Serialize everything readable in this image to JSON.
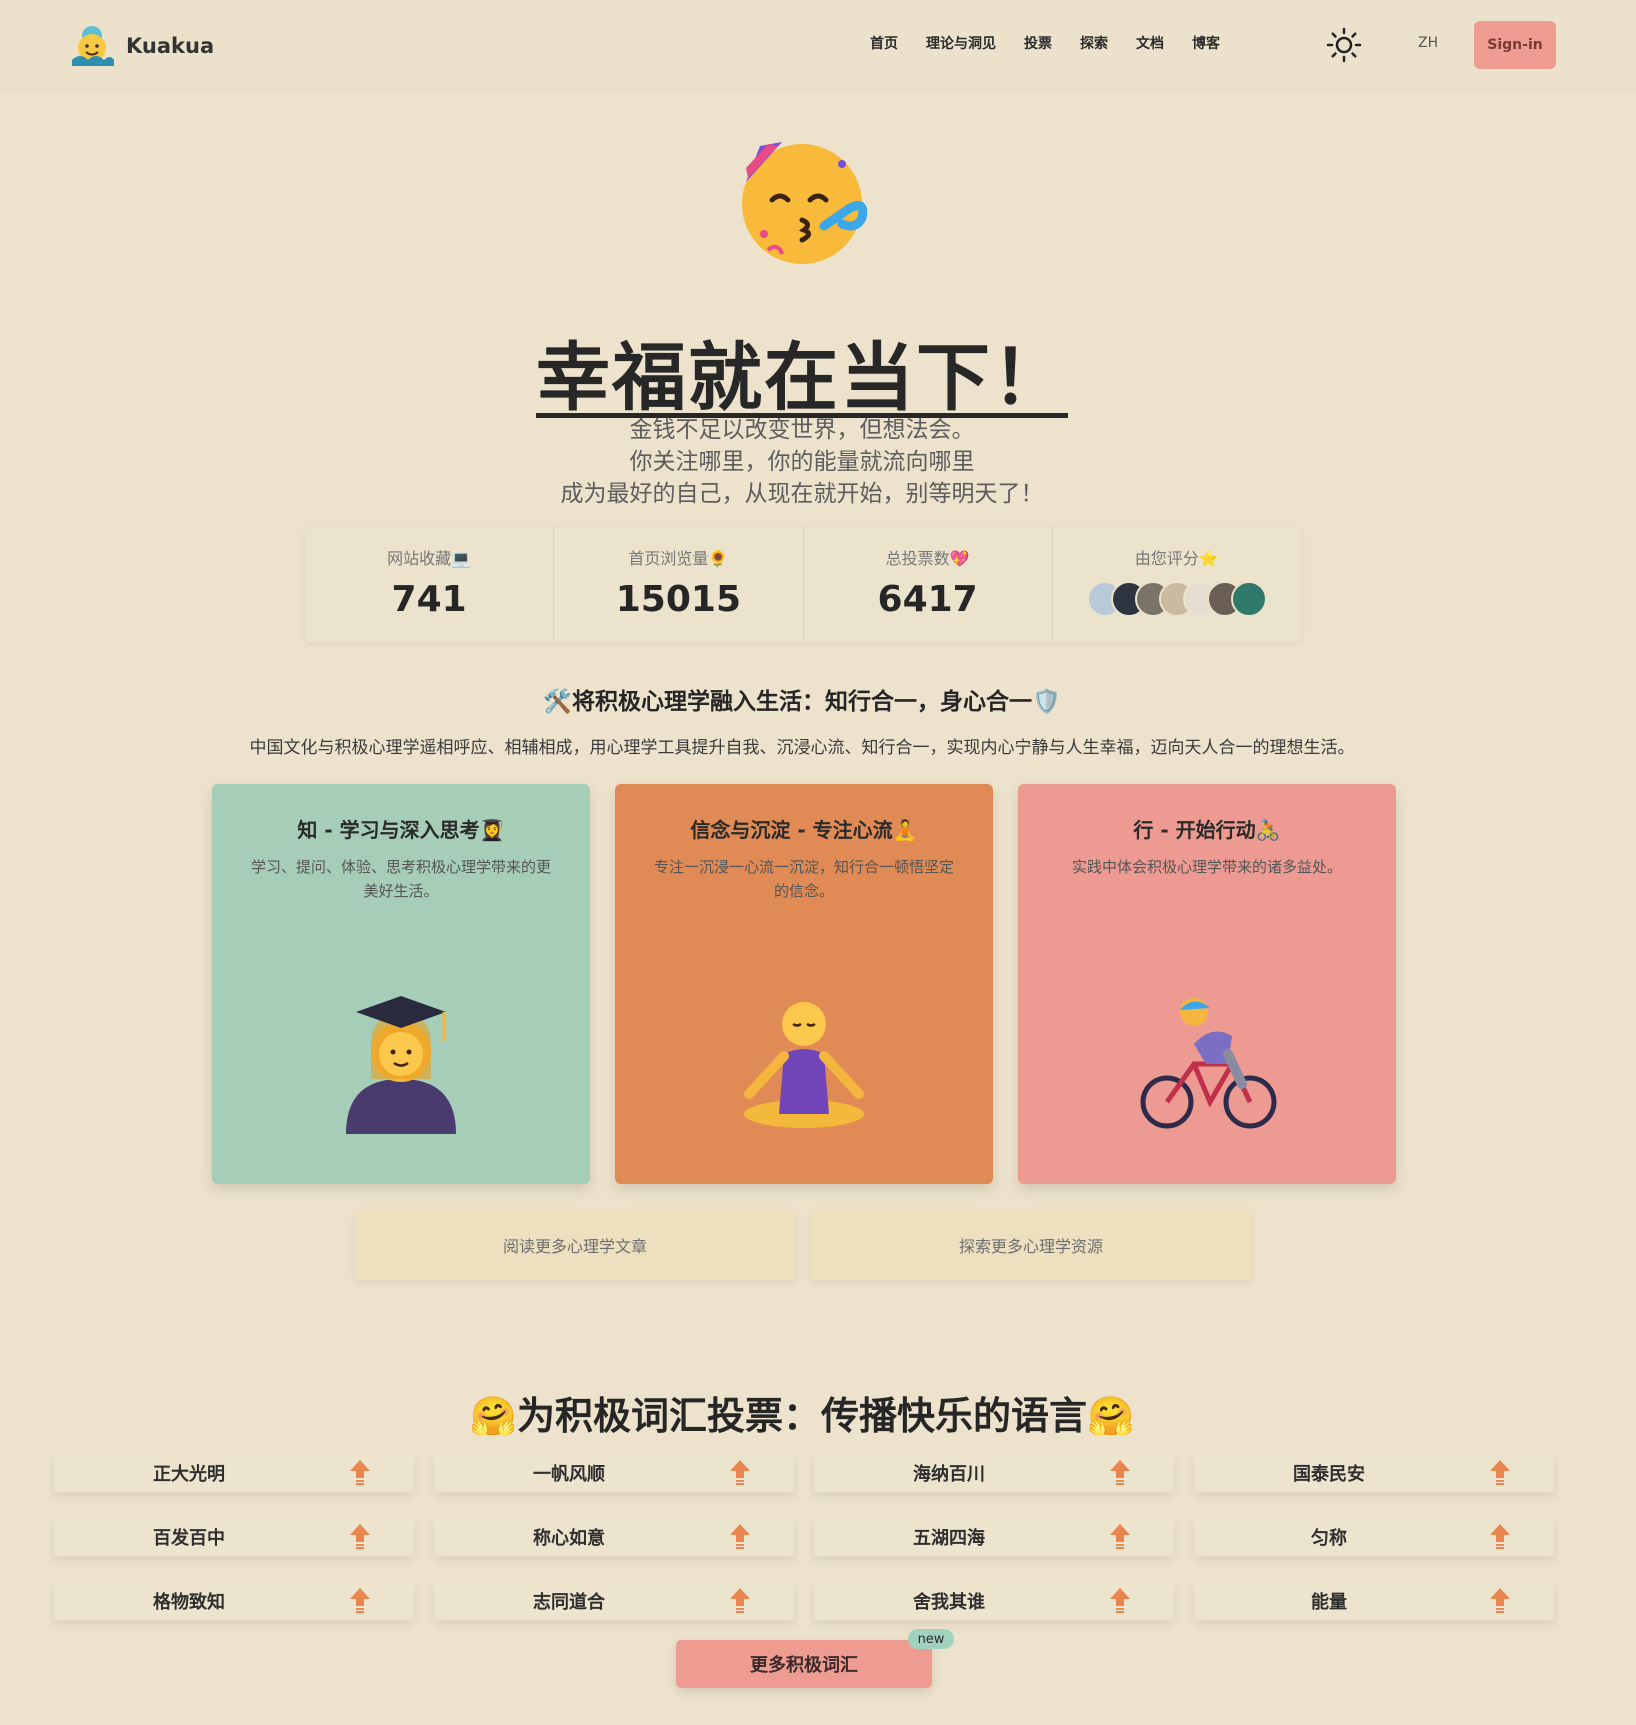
{
  "header": {
    "brand": "Kuakua",
    "nav": [
      "首页",
      "理论与洞见",
      "投票",
      "探索",
      "文档",
      "博客"
    ],
    "lang": "ZH",
    "signin": "Sign-in"
  },
  "hero": {
    "title": "幸福就在当下！",
    "lines": [
      "金钱不足以改变世界，但想法会。",
      "你关注哪里，你的能量就流向哪里",
      "成为最好的自己，从现在就开始，别等明天了！"
    ]
  },
  "stats": [
    {
      "label": "网站收藏💻",
      "value": "741"
    },
    {
      "label": "首页浏览量🌻",
      "value": "15015"
    },
    {
      "label": "总投票数💖",
      "value": "6417"
    },
    {
      "label": "由您评分⭐"
    }
  ],
  "avatar_colors": [
    "#b8c9d8",
    "#2e3440",
    "#7a7468",
    "#cbb9a0",
    "#e6ddd2",
    "#6b5f55",
    "#2f7a6a"
  ],
  "section1": {
    "title": "🛠️将积极心理学融入生活：知行合一，身心合一🛡️",
    "desc": "中国文化与积极心理学遥相呼应、相辅相成，用心理学工具提升自我、沉浸心流、知行合一，实现内心宁静与人生幸福，迈向天人合一的理想生活。",
    "cards": [
      {
        "title": "知 - 学习与深入思考👩‍🎓",
        "desc": "学习、提问、体验、思考积极心理学带来的更美好生活。",
        "color": "#a6cdb7"
      },
      {
        "title": "信念与沉淀 - 专注心流🧘",
        "desc": "专注一沉浸一心流一沉淀，知行合一顿悟坚定的信念。",
        "color": "#e08a55"
      },
      {
        "title": "行 - 开始行动🚴",
        "desc": "实践中体会积极心理学带来的诸多益处。",
        "color": "#ec9a92"
      }
    ],
    "buttons": [
      "阅读更多心理学文章",
      "探索更多心理学资源"
    ]
  },
  "vote": {
    "title": "🤗为积极词汇投票：传播快乐的语言🤗",
    "words": [
      "正大光明",
      "一帆风顺",
      "海纳百川",
      "国泰民安",
      "百发百中",
      "称心如意",
      "五湖四海",
      "匀称",
      "格物致知",
      "志同道合",
      "舍我其谁",
      "能量"
    ],
    "more": "更多积极词汇",
    "badge": "new"
  },
  "colors": {
    "accent": "#ee9c92",
    "background": "#ede3cc",
    "arrow": "#e8864e"
  }
}
